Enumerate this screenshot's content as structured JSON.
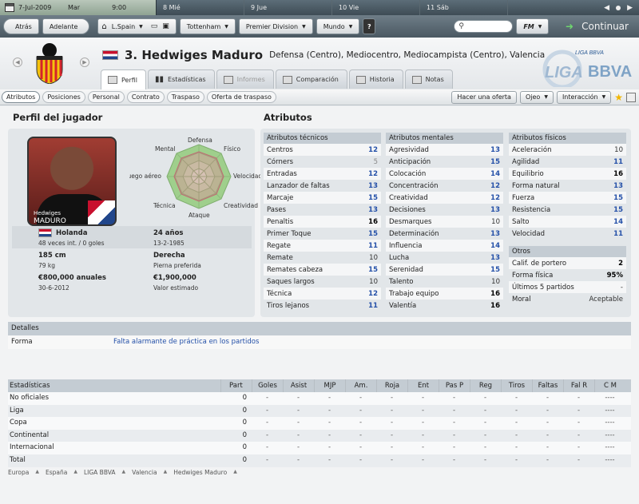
{
  "calendar": {
    "date": "7-Jul-2009",
    "weekday": "Mar",
    "time": "9:00",
    "days": [
      {
        "num": "8",
        "name": "Mié"
      },
      {
        "num": "9",
        "name": "Jue"
      },
      {
        "num": "10",
        "name": "Vie"
      },
      {
        "num": "11",
        "name": "Sáb"
      }
    ]
  },
  "toolbar": {
    "back": "Atrás",
    "forward": "Adelante",
    "league_menu": "L.Spain",
    "club_menu": "Tottenham",
    "competition_menu": "Premier Division",
    "world_menu": "Mundo",
    "help": "?",
    "fm_menu": "FM",
    "continue": "Continuar"
  },
  "player": {
    "number_name": "3. Hedwiges Maduro",
    "positions": "Defensa (Centro), Mediocentro, Mediocampista (Centro), Valencia",
    "photo_first": "Hedwiges",
    "photo_last": "MADURO"
  },
  "tabs": [
    {
      "label": "Perfil"
    },
    {
      "label": "Estadísticas"
    },
    {
      "label": "Informes"
    },
    {
      "label": "Comparación"
    },
    {
      "label": "Historia"
    },
    {
      "label": "Notas"
    }
  ],
  "subtabs": [
    "Atributos",
    "Posiciones",
    "Personal",
    "Contrato",
    "Traspaso",
    "Oferta de traspaso"
  ],
  "actions": {
    "offer": "Hacer una oferta",
    "scout": "Ojeo",
    "interaction": "Interacción"
  },
  "profile": {
    "title": "Perfil del jugador",
    "radar_labels": {
      "defensa": "Defensa",
      "fisico": "Físico",
      "velocidad": "Velocidad",
      "creatividad": "Creatividad",
      "ataque": "Ataque",
      "tecnica": "Técnica",
      "juego_aereo": "Juego aéreo",
      "mental": "Mental"
    },
    "nationality": "Holanda",
    "caps": "48 veces int. / 0 goles",
    "age": "24 años",
    "birth": "13-2-1985",
    "height": "185 cm",
    "weight": "79 kg",
    "foot": "Derecha",
    "foot_label": "Pierna preferida",
    "wage": "€800,000 anuales",
    "contract_end": "30-6-2012",
    "value": "€1,900,000",
    "value_label": "Valor estimado"
  },
  "attributes": {
    "title": "Atributos",
    "technical": {
      "header": "Atributos técnicos",
      "rows": [
        {
          "name": "Centros",
          "value": "12",
          "style": "blue"
        },
        {
          "name": "Córners",
          "value": "5",
          "style": "grey"
        },
        {
          "name": "Entradas",
          "value": "12",
          "style": "blue"
        },
        {
          "name": "Lanzador de faltas",
          "value": "13",
          "style": "blue"
        },
        {
          "name": "Marcaje",
          "value": "15",
          "style": "blue"
        },
        {
          "name": "Pases",
          "value": "13",
          "style": "blue"
        },
        {
          "name": "Penaltis",
          "value": "16",
          "style": "hi"
        },
        {
          "name": "Primer Toque",
          "value": "15",
          "style": "blue"
        },
        {
          "name": "Regate",
          "value": "11",
          "style": "blue"
        },
        {
          "name": "Remate",
          "value": "10",
          "style": "norm"
        },
        {
          "name": "Remates cabeza",
          "value": "15",
          "style": "blue"
        },
        {
          "name": "Saques largos",
          "value": "10",
          "style": "norm"
        },
        {
          "name": "Técnica",
          "value": "12",
          "style": "blue"
        },
        {
          "name": "Tiros lejanos",
          "value": "11",
          "style": "blue"
        }
      ]
    },
    "mental": {
      "header": "Atributos mentales",
      "rows": [
        {
          "name": "Agresividad",
          "value": "13",
          "style": "blue"
        },
        {
          "name": "Anticipación",
          "value": "15",
          "style": "blue"
        },
        {
          "name": "Colocación",
          "value": "14",
          "style": "blue"
        },
        {
          "name": "Concentración",
          "value": "12",
          "style": "blue"
        },
        {
          "name": "Creatividad",
          "value": "12",
          "style": "blue"
        },
        {
          "name": "Decisiones",
          "value": "13",
          "style": "blue"
        },
        {
          "name": "Desmarques",
          "value": "10",
          "style": "norm"
        },
        {
          "name": "Determinación",
          "value": "13",
          "style": "blue"
        },
        {
          "name": "Influencia",
          "value": "14",
          "style": "blue"
        },
        {
          "name": "Lucha",
          "value": "13",
          "style": "blue"
        },
        {
          "name": "Serenidad",
          "value": "15",
          "style": "blue"
        },
        {
          "name": "Talento",
          "value": "10",
          "style": "norm"
        },
        {
          "name": "Trabajo equipo",
          "value": "16",
          "style": "hi"
        },
        {
          "name": "Valentía",
          "value": "16",
          "style": "hi"
        }
      ]
    },
    "physical": {
      "header": "Atributos físicos",
      "rows": [
        {
          "name": "Aceleración",
          "value": "10",
          "style": "norm"
        },
        {
          "name": "Agilidad",
          "value": "11",
          "style": "blue"
        },
        {
          "name": "Equilibrio",
          "value": "16",
          "style": "hi"
        },
        {
          "name": "Forma natural",
          "value": "13",
          "style": "blue"
        },
        {
          "name": "Fuerza",
          "value": "15",
          "style": "blue"
        },
        {
          "name": "Resistencia",
          "value": "15",
          "style": "blue"
        },
        {
          "name": "Salto",
          "value": "14",
          "style": "blue"
        },
        {
          "name": "Velocidad",
          "value": "11",
          "style": "blue"
        }
      ]
    },
    "other": {
      "header": "Otros",
      "rows": [
        {
          "name": "Calif. de portero",
          "value": "2",
          "style": "hi"
        },
        {
          "name": "Forma física",
          "value": "95%",
          "style": "hi"
        },
        {
          "name": "Últimos 5 partidos",
          "value": "-",
          "style": "norm"
        },
        {
          "name": "Moral",
          "value": "Aceptable",
          "style": "norm"
        }
      ]
    }
  },
  "details": {
    "header": "Detalles",
    "label": "Forma",
    "value": "Falta alarmante de práctica en los partidos"
  },
  "stats": {
    "columns": [
      "Estadísticas",
      "Part",
      "Goles",
      "Asist",
      "MJP",
      "Am.",
      "Roja",
      "Ent",
      "Pas P",
      "Reg",
      "Tiros",
      "Faltas",
      "Fal R",
      "C M"
    ],
    "rows": [
      {
        "label": "No oficiales",
        "part": "0",
        "rest": [
          "-",
          "-",
          "-",
          "-",
          "-",
          "-",
          "-",
          "-",
          "-",
          "-",
          "-",
          "----"
        ]
      },
      {
        "label": "Liga",
        "part": "0",
        "rest": [
          "-",
          "-",
          "-",
          "-",
          "-",
          "-",
          "-",
          "-",
          "-",
          "-",
          "-",
          "----"
        ]
      },
      {
        "label": "Copa",
        "part": "0",
        "rest": [
          "-",
          "-",
          "-",
          "-",
          "-",
          "-",
          "-",
          "-",
          "-",
          "-",
          "-",
          "----"
        ]
      },
      {
        "label": "Continental",
        "part": "0",
        "rest": [
          "-",
          "-",
          "-",
          "-",
          "-",
          "-",
          "-",
          "-",
          "-",
          "-",
          "-",
          "----"
        ]
      },
      {
        "label": "Internacional",
        "part": "0",
        "rest": [
          "-",
          "-",
          "-",
          "-",
          "-",
          "-",
          "-",
          "-",
          "-",
          "-",
          "-",
          "----"
        ]
      },
      {
        "label": "Total",
        "part": "0",
        "rest": [
          "-",
          "-",
          "-",
          "-",
          "-",
          "-",
          "-",
          "-",
          "-",
          "-",
          "-",
          "----"
        ]
      }
    ]
  },
  "breadcrumb": [
    "Europa",
    "España",
    "LIGA BBVA",
    "Valencia",
    "Hedwiges Maduro"
  ],
  "logo": {
    "league": "LIGA",
    "league_sub": "BBVA"
  }
}
